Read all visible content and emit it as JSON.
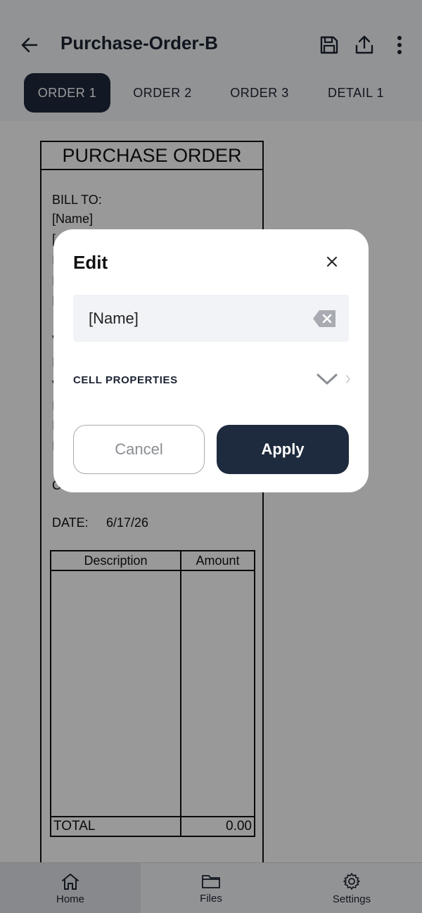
{
  "header": {
    "title": "Purchase-Order-B",
    "icons": [
      "back-arrow-icon",
      "save-icon",
      "share-icon",
      "more-vertical-icon"
    ]
  },
  "tabs": [
    {
      "label": "ORDER 1",
      "active": true
    },
    {
      "label": "ORDER 2",
      "active": false
    },
    {
      "label": "ORDER 3",
      "active": false
    },
    {
      "label": "DETAIL 1",
      "active": false
    }
  ],
  "document": {
    "title": "PURCHASE ORDER",
    "bill_to_label": "BILL TO:",
    "bill_to_name": "[Name]",
    "obscured_initials": [
      "[",
      "I",
      "I",
      "I",
      "V",
      "I",
      "V",
      "I",
      "I",
      "I",
      "C"
    ],
    "date_label": "DATE:",
    "date_value": "6/17/26",
    "table": {
      "headers": [
        "Description",
        "Amount"
      ],
      "total_label": "TOTAL",
      "total_value": "0.00"
    }
  },
  "dialog": {
    "title": "Edit",
    "input_value": "[Name]",
    "cell_properties_label": "CELL PROPERTIES",
    "cancel_label": "Cancel",
    "apply_label": "Apply"
  },
  "bottom_nav": [
    {
      "label": "Home",
      "icon": "home-icon",
      "active": true
    },
    {
      "label": "Files",
      "icon": "folder-icon",
      "active": false
    },
    {
      "label": "Settings",
      "icon": "gear-icon",
      "active": false
    }
  ],
  "colors": {
    "primary_dark": "#1e2a3d",
    "background": "#f4f5f7",
    "field_background": "#f1f3f7"
  }
}
